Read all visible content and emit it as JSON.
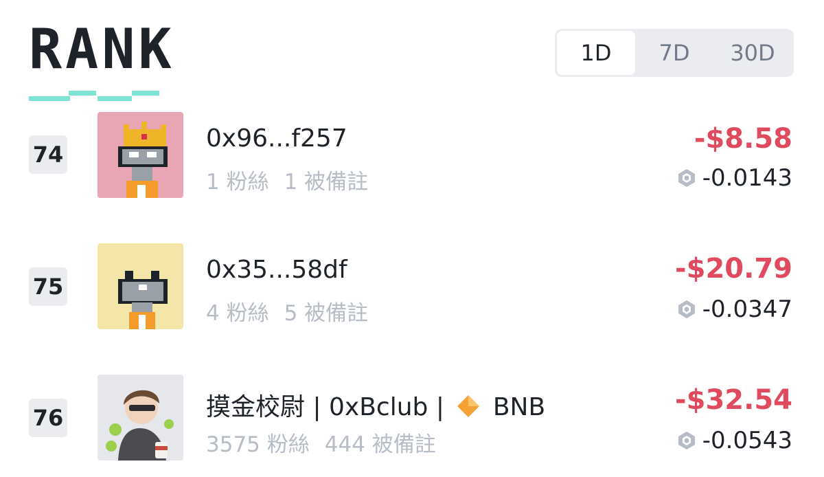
{
  "header": {
    "logo_text": "RANK",
    "periods": [
      {
        "label": "1D",
        "active": true
      },
      {
        "label": "7D",
        "active": false
      },
      {
        "label": "30D",
        "active": false
      }
    ]
  },
  "colors": {
    "negative": "#e04a5e",
    "muted": "#b7bdc6",
    "accent_underline": "#7fe3d4"
  },
  "rows": [
    {
      "rank": "74",
      "name": "0x96...f257",
      "followers": "1 粉絲",
      "noted": "1 被備註",
      "pnl_usd": "-$8.58",
      "pnl_bnb": "-0.0143",
      "avatar_icon": "pixel-crowned-character"
    },
    {
      "rank": "75",
      "name": "0x35...58df",
      "followers": "4 粉絲",
      "noted": "5 被備註",
      "pnl_usd": "-$20.79",
      "pnl_bnb": "-0.0347",
      "avatar_icon": "pixel-character"
    },
    {
      "rank": "76",
      "name_parts": {
        "before": "摸金校尉 | 0xBclub | ",
        "after": " BNB"
      },
      "followers": "3575 粉絲",
      "noted": "444 被備註",
      "pnl_usd": "-$32.54",
      "pnl_bnb": "-0.0543",
      "avatar_icon": "anime-character"
    }
  ]
}
